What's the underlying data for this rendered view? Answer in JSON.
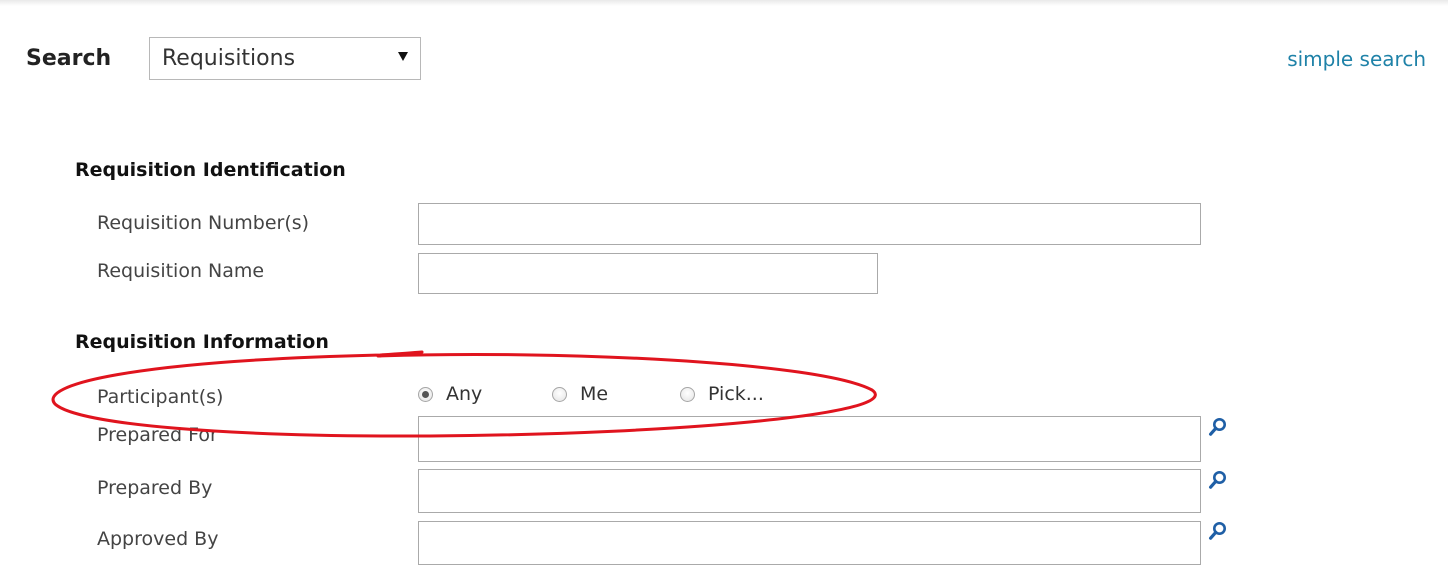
{
  "header": {
    "search_label": "Search",
    "search_type": {
      "selected": "Requisitions"
    },
    "simple_search_link": "simple search"
  },
  "identification": {
    "heading": "Requisition Identification",
    "fields": {
      "requisition_numbers": {
        "label": "Requisition Number(s)",
        "value": ""
      },
      "requisition_name": {
        "label": "Requisition Name",
        "value": ""
      }
    }
  },
  "information": {
    "heading": "Requisition Information",
    "participants": {
      "label": "Participant(s)",
      "options": [
        "Any",
        "Me",
        "Pick..."
      ],
      "selected": "Any"
    },
    "fields": {
      "prepared_for": {
        "label": "Prepared For",
        "value": ""
      },
      "prepared_by": {
        "label": "Prepared By",
        "value": ""
      },
      "approved_by": {
        "label": "Approved By",
        "value": ""
      }
    }
  },
  "icons": {
    "lookup": "magnifier-search-icon",
    "select_arrow": "triangle-down-icon"
  },
  "colors": {
    "link": "#1f82a8",
    "lookup_icon": "#1f5fa6",
    "annotation": "#e0141e"
  }
}
